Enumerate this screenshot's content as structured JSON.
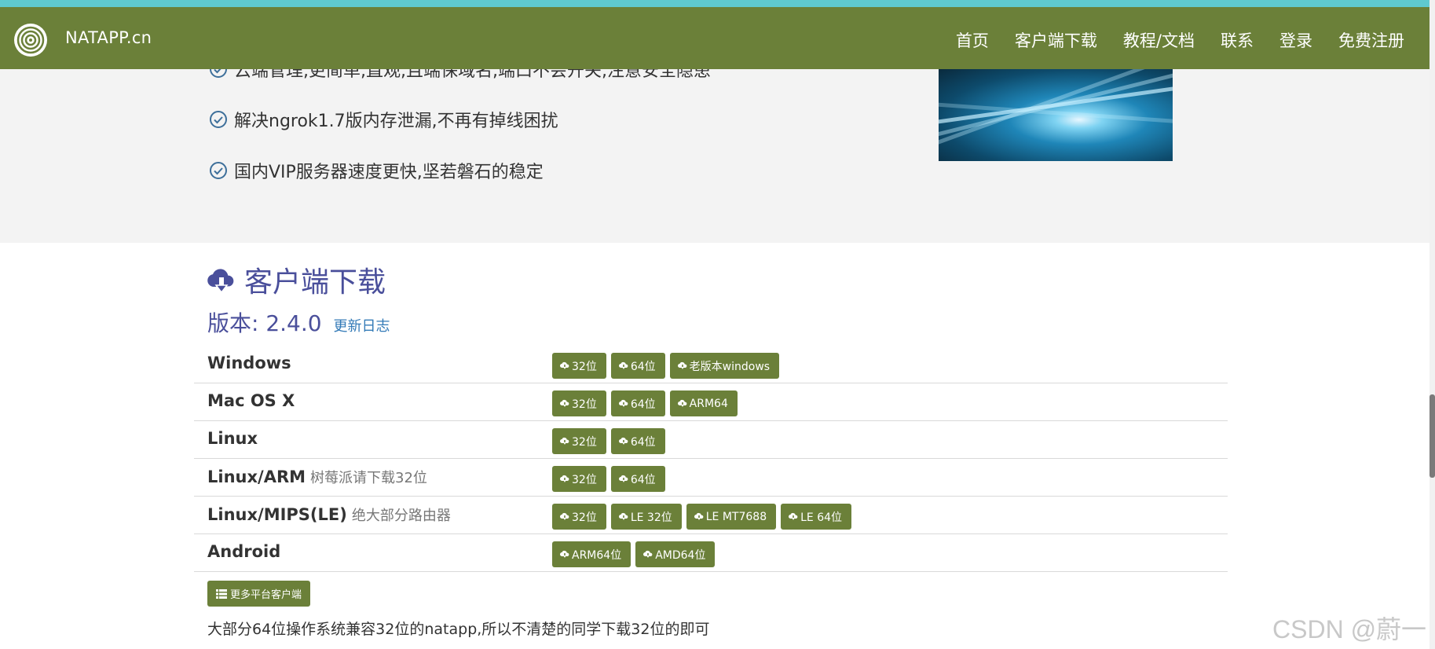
{
  "navbar": {
    "brand": "NATAPP.cn",
    "menu": [
      "首页",
      "客户端下载",
      "教程/文档",
      "联系",
      "登录",
      "免费注册"
    ]
  },
  "hero": {
    "features": [
      "云端管理,更简单,直观,且端保域名,端口不会开关,注意安全隐患",
      "解决ngrok1.7版内存泄漏,不再有掉线困扰",
      "国内VIP服务器速度更快,坚若磐石的稳定"
    ]
  },
  "download": {
    "title": "客户端下载",
    "version_label": "版本: 2.4.0",
    "changelog": "更新日志",
    "rows": [
      {
        "os": "Windows",
        "note": "",
        "buttons": [
          "32位",
          "64位",
          "老版本windows"
        ]
      },
      {
        "os": "Mac OS X",
        "note": "",
        "buttons": [
          "32位",
          "64位",
          "ARM64"
        ]
      },
      {
        "os": "Linux",
        "note": "",
        "buttons": [
          "32位",
          "64位"
        ]
      },
      {
        "os": "Linux/ARM",
        "note": "树莓派请下载32位",
        "buttons": [
          "32位",
          "64位"
        ]
      },
      {
        "os": "Linux/MIPS(LE)",
        "note": "绝大部分路由器",
        "buttons": [
          "32位",
          "LE 32位",
          "LE MT7688",
          "LE 64位"
        ]
      },
      {
        "os": "Android",
        "note": "",
        "buttons": [
          "ARM64位",
          "AMD64位"
        ]
      }
    ],
    "more_button": "更多平台客户端",
    "hint": "大部分64位操作系统兼容32位的natapp,所以不清楚的同学下载32位的即可"
  },
  "watermark": "CSDN @蔚一",
  "colors": {
    "navbar": "#6b8039",
    "top_strip": "#5fc9cf",
    "title": "#4a4f9b",
    "link": "#337ab7",
    "button": "#6b8039"
  }
}
